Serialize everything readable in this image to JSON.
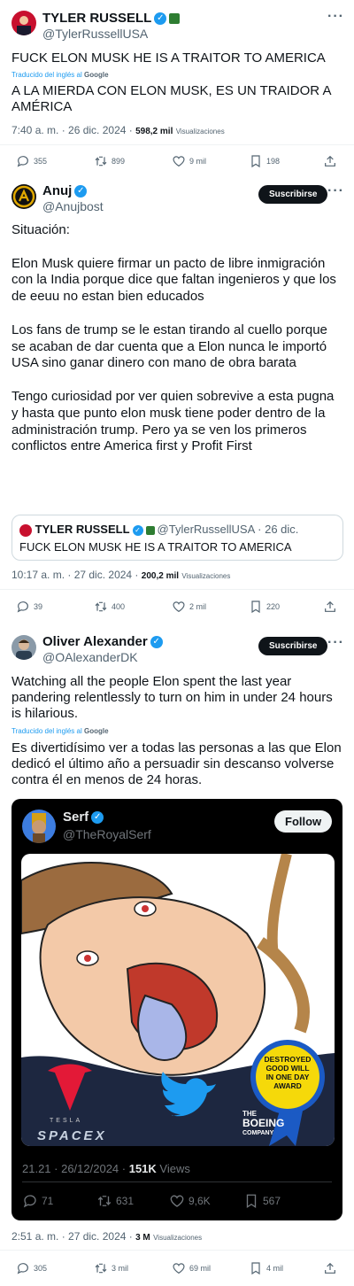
{
  "tweet1": {
    "name": "TYLER RUSSELL",
    "handle": "@TylerRussellUSA",
    "text": "FUCK ELON MUSK HE IS A TRAITOR TO AMERICA",
    "translated_label": "Traducido del inglés al",
    "translated_brand": "Google",
    "translation": "A LA MIERDA CON ELON MUSK, ES UN TRAIDOR A AMÉRICA",
    "time": "7:40 a. m. · 26 dic. 2024 ·",
    "views": "598,2 mil",
    "views_label": "Visualizaciones",
    "replies": "355",
    "retweets": "899",
    "likes": "9 mil",
    "bookmarks": "198"
  },
  "tweet2": {
    "name": "Anuj",
    "handle": "@Anujbost",
    "subscribe": "Suscribirse",
    "text": "Situación:\n\nElon Musk quiere firmar un pacto de libre inmigración con la India porque dice que faltan ingenieros y que los de eeuu no estan bien educados\n\nLos fans de trump se le estan tirando al cuello porque se acaban de dar cuenta que a Elon nunca le importó USA sino ganar dinero con mano de obra barata\n\nTengo curiosidad por ver quien sobrevive a esta pugna y hasta que punto elon musk tiene poder dentro de la administración trump. Pero ya se ven los primeros conflictos entre America first y Profit First",
    "quote_name": "TYLER RUSSELL",
    "quote_handle": "@TylerRussellUSA · 26 dic.",
    "quote_text": "FUCK ELON MUSK HE IS A TRAITOR TO AMERICA",
    "time": "10:17 a. m. · 27 dic. 2024 ·",
    "views": "200,2 mil",
    "views_label": "Visualizaciones",
    "replies": "39",
    "retweets": "400",
    "likes": "2 mil",
    "bookmarks": "220"
  },
  "tweet3": {
    "name": "Oliver Alexander",
    "handle": "@OAlexanderDK",
    "subscribe": "Suscribirse",
    "text": "Watching all the people Elon spent the last year pandering relentlessly to turn on him in under 24 hours is hilarious.",
    "translated_label": "Traducido del inglés al",
    "translated_brand": "Google",
    "translation": "Es divertidísimo ver a todas las personas a las que Elon dedicó el último año a persuadir sin descanso volverse contra él en menos de 24 horas.",
    "time": "2:51 a. m. · 27 dic. 2024 ·",
    "views": "3 M",
    "views_label": "Visualizaciones",
    "replies": "305",
    "retweets": "3 mil",
    "likes": "69 mil",
    "bookmarks": "4 mil"
  },
  "embedded": {
    "name": "Serf",
    "handle": "@TheRoyalSerf",
    "follow": "Follow",
    "image": {
      "brand_tesla": "TESLA",
      "brand_spacex": "SPACEX",
      "brand_boeing_1": "THE",
      "brand_boeing_2": "BOEING",
      "brand_boeing_3": "COMPANY",
      "award": "DESTROYED GOOD WILL IN ONE DAY AWARD"
    },
    "time": "21.21 · 26/12/2024 ·",
    "views": "151K",
    "views_label": "Views",
    "replies": "71",
    "retweets": "631",
    "likes": "9,6K",
    "bookmarks": "567"
  },
  "colors": {
    "accent": "#1d9bf0",
    "text": "#0f1419",
    "muted": "#536471",
    "card_bg": "#000000"
  }
}
